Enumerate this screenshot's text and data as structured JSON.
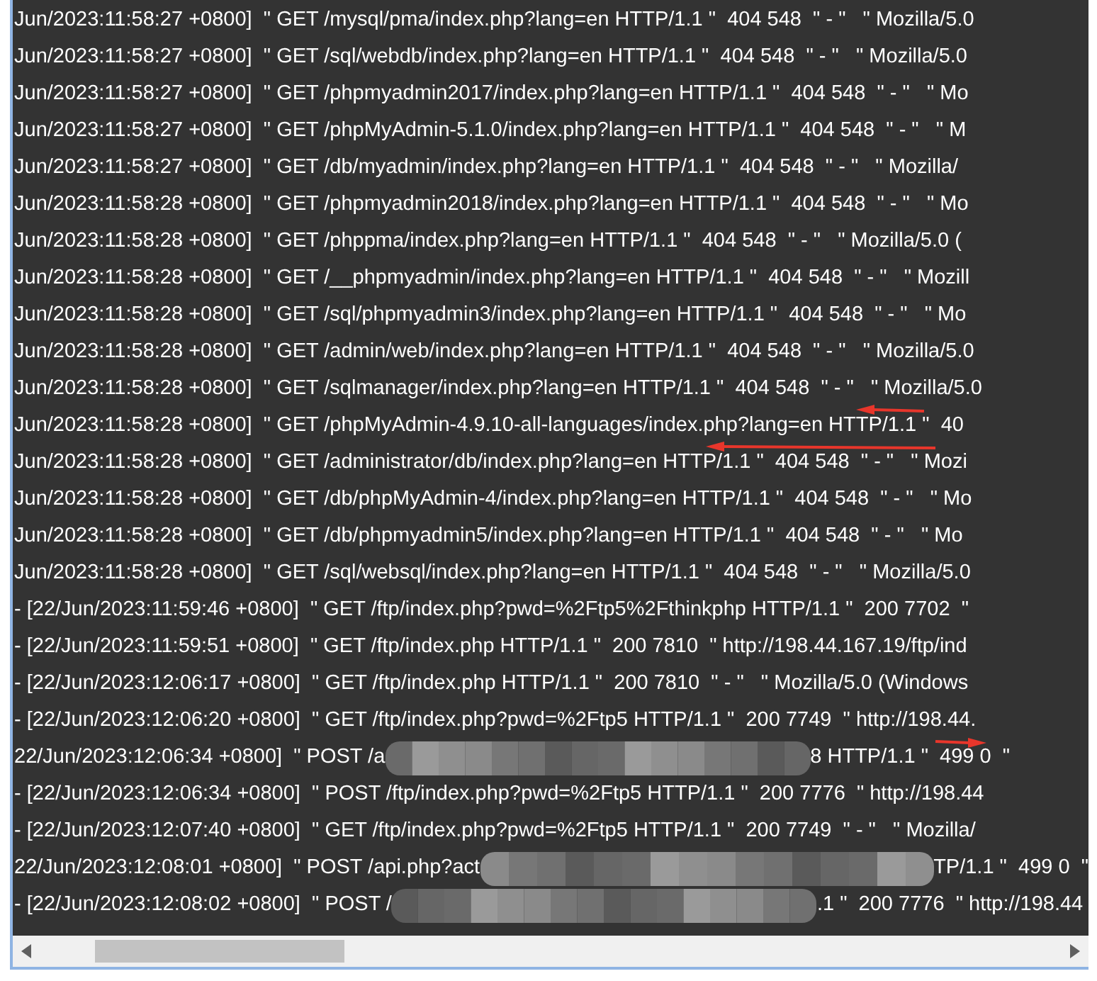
{
  "log_lines": [
    {
      "kind": "plain",
      "text": "Jun/2023:11:58:27 +0800]  \" GET /mysql/pma/index.php?lang=en HTTP/1.1 \"  404 548  \" - \"   \" Mozilla/5.0"
    },
    {
      "kind": "plain",
      "text": "Jun/2023:11:58:27 +0800]  \" GET /sql/webdb/index.php?lang=en HTTP/1.1 \"  404 548  \" - \"   \" Mozilla/5.0"
    },
    {
      "kind": "plain",
      "text": "Jun/2023:11:58:27 +0800]  \" GET /phpmyadmin2017/index.php?lang=en HTTP/1.1 \"  404 548  \" - \"   \" Mo"
    },
    {
      "kind": "plain",
      "text": "Jun/2023:11:58:27 +0800]  \" GET /phpMyAdmin-5.1.0/index.php?lang=en HTTP/1.1 \"  404 548  \" - \"   \" M"
    },
    {
      "kind": "plain",
      "text": "Jun/2023:11:58:27 +0800]  \" GET /db/myadmin/index.php?lang=en HTTP/1.1 \"  404 548  \" - \"   \" Mozilla/"
    },
    {
      "kind": "plain",
      "text": "Jun/2023:11:58:28 +0800]  \" GET /phpmyadmin2018/index.php?lang=en HTTP/1.1 \"  404 548  \" - \"   \" Mo"
    },
    {
      "kind": "plain",
      "text": "Jun/2023:11:58:28 +0800]  \" GET /phppma/index.php?lang=en HTTP/1.1 \"  404 548  \" - \"   \" Mozilla/5.0 ("
    },
    {
      "kind": "plain",
      "text": "Jun/2023:11:58:28 +0800]  \" GET /__phpmyadmin/index.php?lang=en HTTP/1.1 \"  404 548  \" - \"   \" Mozill"
    },
    {
      "kind": "plain",
      "text": "Jun/2023:11:58:28 +0800]  \" GET /sql/phpmyadmin3/index.php?lang=en HTTP/1.1 \"  404 548  \" - \"   \" Mo"
    },
    {
      "kind": "plain",
      "text": "Jun/2023:11:58:28 +0800]  \" GET /admin/web/index.php?lang=en HTTP/1.1 \"  404 548  \" - \"   \" Mozilla/5.0"
    },
    {
      "kind": "plain",
      "text": "Jun/2023:11:58:28 +0800]  \" GET /sqlmanager/index.php?lang=en HTTP/1.1 \"  404 548  \" - \"   \" Mozilla/5.0"
    },
    {
      "kind": "plain",
      "text": "Jun/2023:11:58:28 +0800]  \" GET /phpMyAdmin-4.9.10-all-languages/index.php?lang=en HTTP/1.1 \"  40"
    },
    {
      "kind": "plain",
      "text": "Jun/2023:11:58:28 +0800]  \" GET /administrator/db/index.php?lang=en HTTP/1.1 \"  404 548  \" - \"   \" Mozi"
    },
    {
      "kind": "plain",
      "text": "Jun/2023:11:58:28 +0800]  \" GET /db/phpMyAdmin-4/index.php?lang=en HTTP/1.1 \"  404 548  \" - \"   \" Mo"
    },
    {
      "kind": "plain",
      "text": "Jun/2023:11:58:28 +0800]  \" GET /db/phpmyadmin5/index.php?lang=en HTTP/1.1 \"  404 548  \" - \"   \" Mo"
    },
    {
      "kind": "plain",
      "text": "Jun/2023:11:58:28 +0800]  \" GET /sql/websql/index.php?lang=en HTTP/1.1 \"  404 548  \" - \"   \" Mozilla/5.0"
    },
    {
      "kind": "plain",
      "text": "- [22/Jun/2023:11:59:46 +0800]  \" GET /ftp/index.php?pwd=%2Ftp5%2Fthinkphp HTTP/1.1 \"  200 7702  \""
    },
    {
      "kind": "plain",
      "text": "- [22/Jun/2023:11:59:51 +0800]  \" GET /ftp/index.php HTTP/1.1 \"  200 7810  \" http://198.44.167.19/ftp/ind"
    },
    {
      "kind": "plain",
      "text": "- [22/Jun/2023:12:06:17 +0800]  \" GET /ftp/index.php HTTP/1.1 \"  200 7810  \" - \"   \" Mozilla/5.0 (Windows"
    },
    {
      "kind": "plain",
      "text": "- [22/Jun/2023:12:06:20 +0800]  \" GET /ftp/index.php?pwd=%2Ftp5 HTTP/1.1 \"  200 7749  \" http://198.44."
    },
    {
      "kind": "redacted",
      "text": "22/Jun/2023:12:06:34 +0800]  \" POST /a",
      "text_after": "8 HTTP/1.1 \"  499 0  \""
    },
    {
      "kind": "plain",
      "text": "- [22/Jun/2023:12:06:34 +0800]  \" POST /ftp/index.php?pwd=%2Ftp5 HTTP/1.1 \"  200 7776  \" http://198.44"
    },
    {
      "kind": "plain",
      "text": "- [22/Jun/2023:12:07:40 +0800]  \" GET /ftp/index.php?pwd=%2Ftp5 HTTP/1.1 \"  200 7749  \" - \"   \" Mozilla/"
    },
    {
      "kind": "redacted",
      "text": "22/Jun/2023:12:08:01 +0800]  \" POST /api.php?act",
      "text_after": "TP/1.1 \"  499 0  \""
    },
    {
      "kind": "redacted",
      "text": "- [22/Jun/2023:12:08:02 +0800]  \" POST /",
      "text_after": ".1 \"  200 7776  \" http://198.44"
    }
  ]
}
